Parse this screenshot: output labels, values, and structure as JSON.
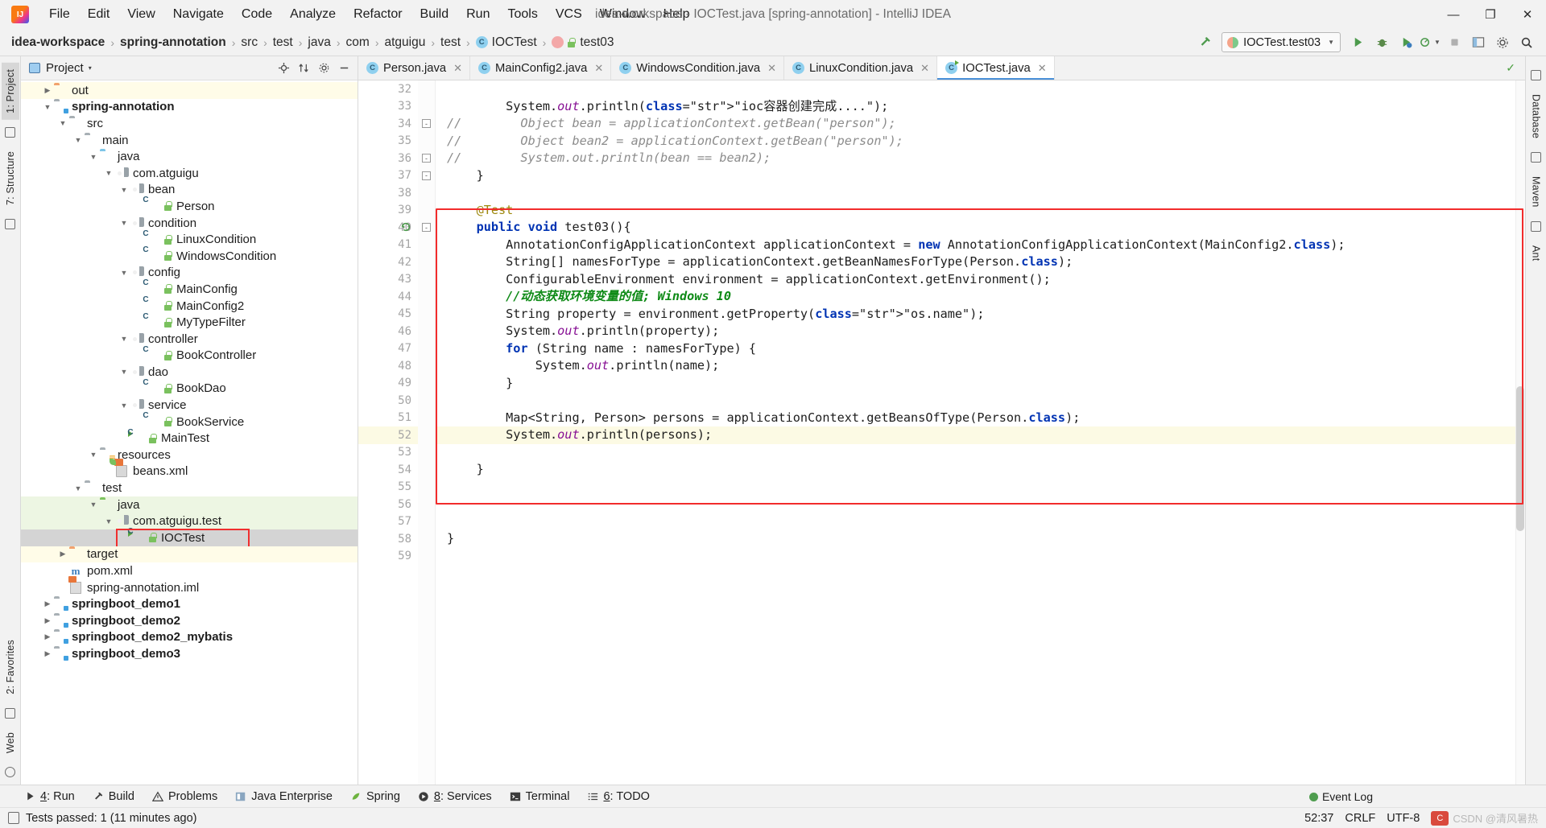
{
  "window": {
    "title": "idea-workspace - IOCTest.java [spring-annotation] - IntelliJ IDEA",
    "minimize": "—",
    "maximize": "❐",
    "close": "✕"
  },
  "menubar": {
    "logo": "ij-logo",
    "items": [
      "File",
      "Edit",
      "View",
      "Navigate",
      "Code",
      "Analyze",
      "Refactor",
      "Build",
      "Run",
      "Tools",
      "VCS",
      "Window",
      "Help"
    ]
  },
  "breadcrumb": {
    "items": [
      "idea-workspace",
      "spring-annotation",
      "src",
      "test",
      "java",
      "com",
      "atguigu",
      "test",
      "IOCTest",
      "test03"
    ],
    "separator": "›"
  },
  "toolbar": {
    "build_icon": "hammer-icon",
    "run_config": "IOCTest.test03",
    "run_icon": "▶",
    "debug_icon": "debug-icon",
    "coverage_icon": "coverage-icon",
    "profile_icon": "profile-icon",
    "stop_icon": "■",
    "layout_icon": "layout-icon",
    "settings_icon": "⚙",
    "search_icon": "⚲"
  },
  "left_rail": {
    "project_tab": "1: Project",
    "structure_tab": "7: Structure",
    "favorites_tab": "2: Favorites",
    "web_tab": "Web"
  },
  "right_rail": {
    "database_tab": "Database",
    "maven_tab": "Maven",
    "ant_tab": "Ant"
  },
  "project_panel": {
    "title": "Project",
    "caret": "▾",
    "tools": [
      "⊕",
      "⇅",
      "⚙",
      "−"
    ],
    "tree": [
      {
        "label": "out",
        "indent": 1,
        "icon": "folder-orange",
        "twisty": "right",
        "hl": "yellow"
      },
      {
        "label": "spring-annotation",
        "indent": 1,
        "icon": "folder-module",
        "twisty": "down",
        "bold": true
      },
      {
        "label": "src",
        "indent": 2,
        "icon": "folder-gray",
        "twisty": "down"
      },
      {
        "label": "main",
        "indent": 3,
        "icon": "folder-gray",
        "twisty": "down"
      },
      {
        "label": "java",
        "indent": 4,
        "icon": "folder-blue",
        "twisty": "down"
      },
      {
        "label": "com.atguigu",
        "indent": 5,
        "icon": "package",
        "twisty": "down"
      },
      {
        "label": "bean",
        "indent": 6,
        "icon": "package",
        "twisty": "down"
      },
      {
        "label": "Person",
        "indent": 7,
        "icon": "class",
        "twisty": "none",
        "lock": true
      },
      {
        "label": "condition",
        "indent": 6,
        "icon": "package",
        "twisty": "down"
      },
      {
        "label": "LinuxCondition",
        "indent": 7,
        "icon": "class",
        "twisty": "none",
        "lock": true
      },
      {
        "label": "WindowsCondition",
        "indent": 7,
        "icon": "class",
        "twisty": "none",
        "lock": true
      },
      {
        "label": "config",
        "indent": 6,
        "icon": "package",
        "twisty": "down"
      },
      {
        "label": "MainConfig",
        "indent": 7,
        "icon": "class",
        "twisty": "none",
        "lock": true
      },
      {
        "label": "MainConfig2",
        "indent": 7,
        "icon": "class",
        "twisty": "none",
        "lock": true
      },
      {
        "label": "MyTypeFilter",
        "indent": 7,
        "icon": "class",
        "twisty": "none",
        "lock": true
      },
      {
        "label": "controller",
        "indent": 6,
        "icon": "package",
        "twisty": "down"
      },
      {
        "label": "BookController",
        "indent": 7,
        "icon": "class",
        "twisty": "none",
        "lock": true
      },
      {
        "label": "dao",
        "indent": 6,
        "icon": "package",
        "twisty": "down"
      },
      {
        "label": "BookDao",
        "indent": 7,
        "icon": "class",
        "twisty": "none",
        "lock": true
      },
      {
        "label": "service",
        "indent": 6,
        "icon": "package",
        "twisty": "down"
      },
      {
        "label": "BookService",
        "indent": 7,
        "icon": "class",
        "twisty": "none",
        "lock": true
      },
      {
        "label": "MainTest",
        "indent": 6,
        "icon": "class-run",
        "twisty": "none",
        "lock": true
      },
      {
        "label": "resources",
        "indent": 4,
        "icon": "folder-res",
        "twisty": "down"
      },
      {
        "label": "beans.xml",
        "indent": 5,
        "icon": "xml-spring",
        "twisty": "none"
      },
      {
        "label": "test",
        "indent": 3,
        "icon": "folder-gray",
        "twisty": "down"
      },
      {
        "label": "java",
        "indent": 4,
        "icon": "folder-green",
        "twisty": "down",
        "hl": "green"
      },
      {
        "label": "com.atguigu.test",
        "indent": 5,
        "icon": "package",
        "twisty": "down",
        "hl": "green"
      },
      {
        "label": "IOCTest",
        "indent": 6,
        "icon": "class-run",
        "twisty": "none",
        "lock": true,
        "hl": "sel",
        "boxed": true
      },
      {
        "label": "target",
        "indent": 2,
        "icon": "folder-orange",
        "twisty": "right",
        "hl": "yellow"
      },
      {
        "label": "pom.xml",
        "indent": 2,
        "icon": "maven",
        "twisty": "none"
      },
      {
        "label": "spring-annotation.iml",
        "indent": 2,
        "icon": "iml",
        "twisty": "none"
      },
      {
        "label": "springboot_demo1",
        "indent": 1,
        "icon": "folder-module",
        "twisty": "right",
        "bold": true
      },
      {
        "label": "springboot_demo2",
        "indent": 1,
        "icon": "folder-module",
        "twisty": "right",
        "bold": true
      },
      {
        "label": "springboot_demo2_mybatis",
        "indent": 1,
        "icon": "folder-module",
        "twisty": "right",
        "bold": true
      },
      {
        "label": "springboot_demo3",
        "indent": 1,
        "icon": "folder-module",
        "twisty": "right",
        "bold": true
      }
    ]
  },
  "editor": {
    "tabs": [
      {
        "label": "Person.java",
        "active": false,
        "runnable": false
      },
      {
        "label": "MainConfig2.java",
        "active": false,
        "runnable": false
      },
      {
        "label": "WindowsCondition.java",
        "active": false,
        "runnable": false
      },
      {
        "label": "LinuxCondition.java",
        "active": false,
        "runnable": false
      },
      {
        "label": "IOCTest.java",
        "active": true,
        "runnable": true
      }
    ],
    "close_glyph": "✕",
    "inspection_ok": "✓",
    "first_line": 32,
    "current_line": 52,
    "lines": [
      {
        "n": 32,
        "text": ""
      },
      {
        "n": 33,
        "text": "        System.out.println(\"ioc容器创建完成....\");"
      },
      {
        "n": 34,
        "text": "//        Object bean = applicationContext.getBean(\"person\");"
      },
      {
        "n": 35,
        "text": "//        Object bean2 = applicationContext.getBean(\"person\");"
      },
      {
        "n": 36,
        "text": "//        System.out.println(bean == bean2);"
      },
      {
        "n": 37,
        "text": "    }"
      },
      {
        "n": 38,
        "text": ""
      },
      {
        "n": 39,
        "text": "    @Test"
      },
      {
        "n": 40,
        "text": "    public void test03(){"
      },
      {
        "n": 41,
        "text": "        AnnotationConfigApplicationContext applicationContext = new AnnotationConfigApplicationContext(MainConfig2.class);"
      },
      {
        "n": 42,
        "text": "        String[] namesForType = applicationContext.getBeanNamesForType(Person.class);"
      },
      {
        "n": 43,
        "text": "        ConfigurableEnvironment environment = applicationContext.getEnvironment();"
      },
      {
        "n": 44,
        "text": "        //动态获取环境变量的值; Windows 10"
      },
      {
        "n": 45,
        "text": "        String property = environment.getProperty(\"os.name\");"
      },
      {
        "n": 46,
        "text": "        System.out.println(property);"
      },
      {
        "n": 47,
        "text": "        for (String name : namesForType) {"
      },
      {
        "n": 48,
        "text": "            System.out.println(name);"
      },
      {
        "n": 49,
        "text": "        }"
      },
      {
        "n": 50,
        "text": ""
      },
      {
        "n": 51,
        "text": "        Map<String, Person> persons = applicationContext.getBeansOfType(Person.class);"
      },
      {
        "n": 52,
        "text": "        System.out.println(persons);"
      },
      {
        "n": 53,
        "text": ""
      },
      {
        "n": 54,
        "text": "    }"
      },
      {
        "n": 55,
        "text": ""
      },
      {
        "n": 56,
        "text": ""
      },
      {
        "n": 57,
        "text": ""
      },
      {
        "n": 58,
        "text": "}"
      },
      {
        "n": 59,
        "text": ""
      }
    ]
  },
  "bottom_tools": [
    {
      "num": "4",
      "label": "Run",
      "icon": "play-icon"
    },
    {
      "num": "",
      "label": "Build",
      "icon": "hammer-icon"
    },
    {
      "num": "",
      "label": "Problems",
      "icon": "warning-icon"
    },
    {
      "num": "",
      "label": "Java Enterprise",
      "icon": "javaee-icon"
    },
    {
      "num": "",
      "label": "Spring",
      "icon": "spring-leaf-icon"
    },
    {
      "num": "8",
      "label": "Services",
      "icon": "services-icon"
    },
    {
      "num": "",
      "label": "Terminal",
      "icon": "terminal-icon"
    },
    {
      "num": "6",
      "label": "TODO",
      "icon": "todo-icon"
    }
  ],
  "statusbar": {
    "message": "Tests passed: 1 (11 minutes ago)",
    "caret_position": "52:37",
    "line_sep": "CRLF",
    "encoding": "UTF-8",
    "event_log": "Event Log",
    "watermark": "CSDN @清风暑热"
  }
}
